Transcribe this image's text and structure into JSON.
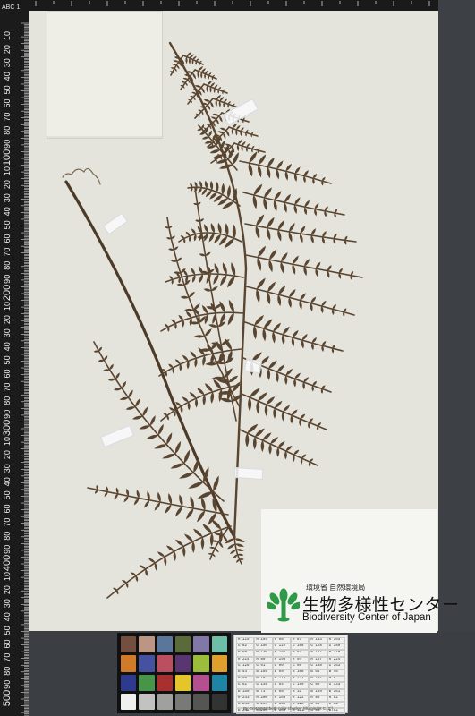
{
  "image": {
    "subject": "fern herbarium specimen",
    "paper_color": "#e4e4dc",
    "frond_color": "#5a4530",
    "background_color": "#3a3c40"
  },
  "ruler": {
    "label_top": "ABC 1",
    "marks": [
      "10",
      "20",
      "30",
      "40",
      "50",
      "60",
      "70",
      "80",
      "90",
      "100",
      "10",
      "20",
      "30",
      "40",
      "50",
      "60",
      "70",
      "80",
      "90",
      "200",
      "10",
      "20",
      "30",
      "40",
      "50",
      "60",
      "70",
      "80",
      "90",
      "300",
      "10",
      "20",
      "30",
      "40",
      "50",
      "60",
      "70",
      "80",
      "90",
      "400",
      "10",
      "20",
      "30",
      "40",
      "50",
      "60",
      "70",
      "80",
      "90",
      "500"
    ]
  },
  "logo": {
    "agency": "環境省 自然環境局",
    "center_name_jp": "生物多様性センター",
    "center_name_en": "Biodiversity Center of Japan",
    "plant_color": "#2e9a48"
  },
  "color_checker": {
    "swatches": [
      "#734f3f",
      "#bd9584",
      "#5b769b",
      "#5a6a3a",
      "#8278a8",
      "#6ebfa8",
      "#d17b28",
      "#4552a0",
      "#bb4f60",
      "#5a3670",
      "#9cbc3c",
      "#e0a12c",
      "#2d3a8d",
      "#479548",
      "#a8302f",
      "#e4c52a",
      "#b45090",
      "#1f85a7",
      "#f0f0ee",
      "#c2c2c0",
      "#a0a09e",
      "#797977",
      "#555554",
      "#333333"
    ]
  },
  "reference_card": {
    "values": [
      "R 115",
      "R 194",
      "R 98",
      "R 87",
      "R 133",
      "R 103",
      "G 82",
      "G 150",
      "G 122",
      "G 108",
      "G 128",
      "G 189",
      "B 68",
      "B 130",
      "B 157",
      "B 67",
      "B 177",
      "B 170",
      "R 214",
      "R 80",
      "R 193",
      "R 94",
      "R 157",
      "R 224",
      "G 126",
      "G 91",
      "G 90",
      "G 60",
      "G 188",
      "G 163",
      "B 44",
      "B 166",
      "B 99",
      "B 108",
      "B 64",
      "B 46",
      "R 56",
      "R 70",
      "R 175",
      "R 231",
      "R 187",
      "R 8",
      "G 61",
      "G 148",
      "G 54",
      "G 199",
      "G 86",
      "G 133",
      "B 150",
      "B 73",
      "B 60",
      "B 31",
      "B 149",
      "B 161",
      "R 243",
      "R 200",
      "R 160",
      "R 122",
      "R 85",
      "R 52",
      "G 243",
      "G 200",
      "G 160",
      "G 122",
      "G 85",
      "G 52",
      "B 242",
      "B 200",
      "B 160",
      "B 121",
      "B 85",
      "B 52"
    ],
    "note": "By GretagMacbeth color checker (Illuminant C, 2°)"
  }
}
